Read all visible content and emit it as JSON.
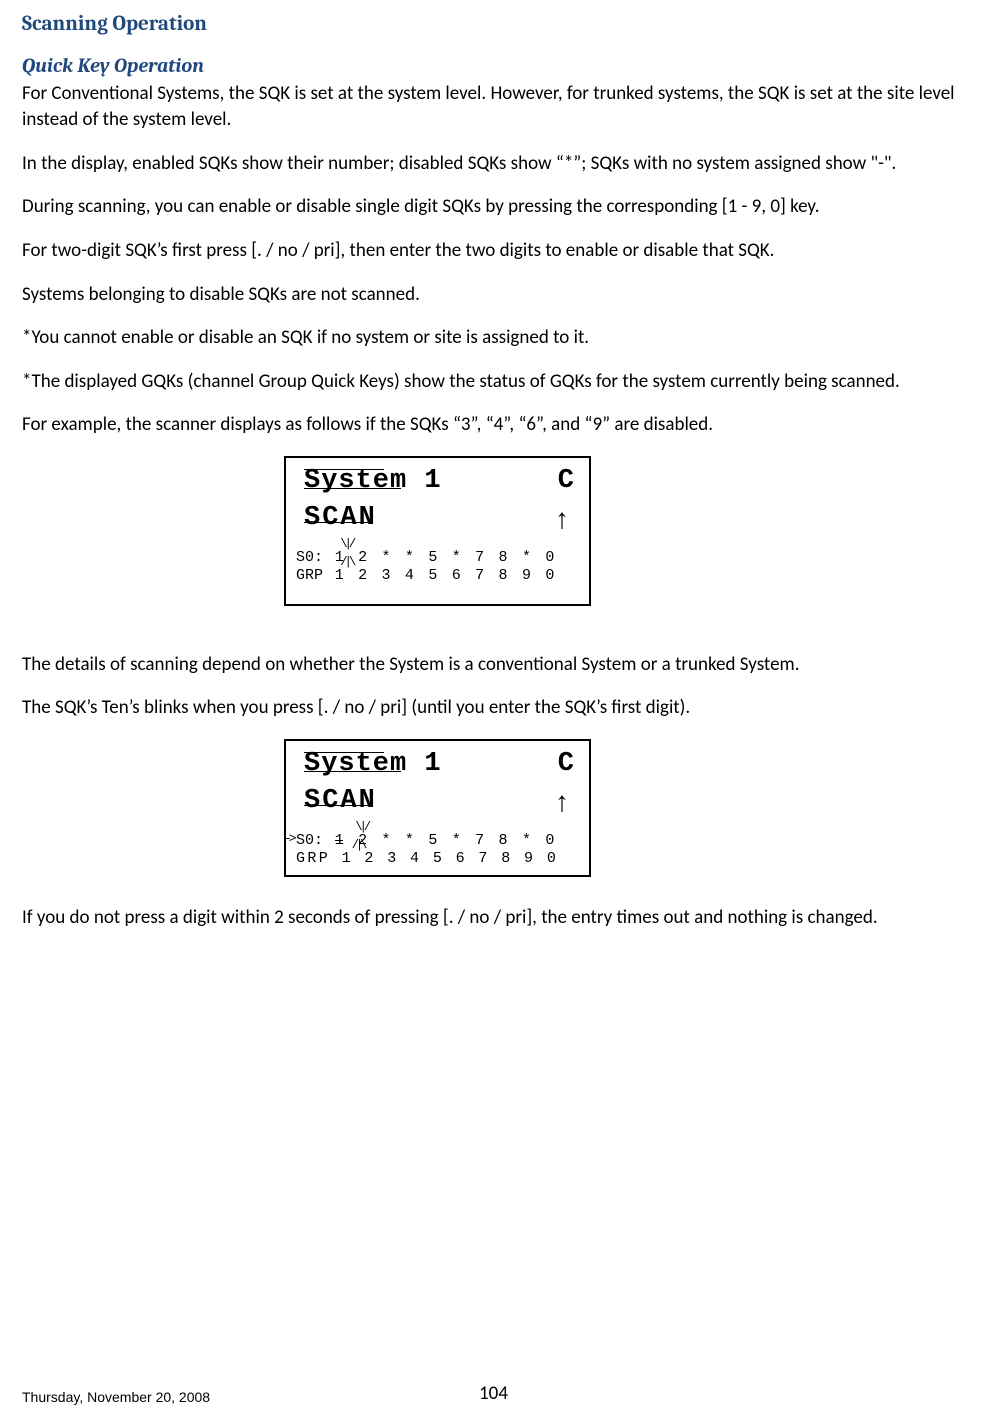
{
  "headings": {
    "h1": "Scanning Operation",
    "h2": "Quick Key Operation"
  },
  "paragraphs": {
    "p1": "For Conventional Systems, the SQK is set at the system level. However, for trunked systems, the SQK is set at the site level instead of the system level.",
    "p2": "In the display, enabled SQKs show their number; disabled SQKs show “*”; SQKs with no system assigned show \"-\".",
    "p3": "During scanning, you can enable or disable single digit SQKs by pressing the corresponding [1 - 9, 0] key.",
    "p4": "For two-digit SQK’s first press [. / no / pri], then enter the two digits to enable or disable that SQK.",
    "p5": "Systems belonging to disable SQKs are not scanned.",
    "p6": "*You cannot enable or disable an SQK if no system or site is assigned to it.",
    "p7": "*The displayed GQKs (channel Group Quick Keys) show the status of GQKs for the system currently being scanned.",
    "p8": "For example, the scanner displays as follows if the SQKs “3”, “4”, “6”, and “9” are disabled.",
    "p9": "The details of scanning depend on whether the System is a conventional System or a trunked System.",
    "p10": "The SQK’s Ten’s blinks when you press [. / no / pri] (until you enter the SQK’s first digit).",
    "p11": "If you do not press a digit within 2 seconds of pressing [. / no / pri], the entry times out and nothing is changed."
  },
  "display1": {
    "line1_left": "System 1",
    "line1_right": "C",
    "line2_left": "SCAN",
    "line2_arrow": "↑",
    "s0_label": "S0:",
    "s0_digits": "1 2 * * 5 * 7 8 * 0",
    "grp_label": "GRP",
    "grp_digits": "1 2 3 4 5 6 7 8 9 0"
  },
  "display2": {
    "line1_left": "System 1",
    "line1_right": "C",
    "line2_left": "SCAN",
    "line2_arrow": "↑",
    "s0_label": "S0:",
    "s0_digits": "1 2 * * 5 * 7 8 * 0",
    "grp_full": "GRP 1 2 3 4 5 6 7 8 9 0"
  },
  "footer": {
    "date": "Thursday, November 20, 2008",
    "page": "104"
  }
}
